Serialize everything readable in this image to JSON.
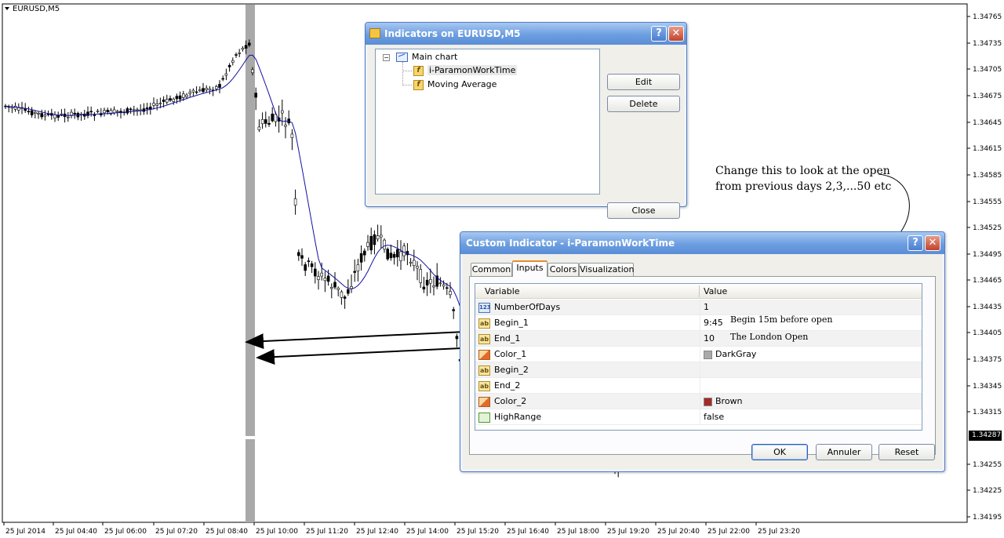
{
  "chart": {
    "title": "EURUSD,M5",
    "current_price": "1.34287",
    "price_labels": [
      "1.34765",
      "1.34735",
      "1.34705",
      "1.34675",
      "1.34645",
      "1.34615",
      "1.34585",
      "1.34555",
      "1.34525",
      "1.34495",
      "1.34465",
      "1.34435",
      "1.34405",
      "1.34375",
      "1.34345",
      "1.34315",
      "1.34255",
      "1.34225",
      "1.34195"
    ],
    "time_labels": [
      "25 Jul 2014",
      "25 Jul 04:40",
      "25 Jul 06:00",
      "25 Jul 07:20",
      "25 Jul 08:40",
      "25 Jul 10:00",
      "25 Jul 11:20",
      "25 Jul 12:40",
      "25 Jul 14:00",
      "25 Jul 15:20",
      "25 Jul 16:40",
      "25 Jul 18:00",
      "25 Jul 19:20",
      "25 Jul 20:40",
      "25 Jul 22:00",
      "25 Jul 23:20"
    ]
  },
  "indicators_dialog": {
    "title": "Indicators on EURUSD,M5",
    "tree": {
      "root": "Main chart",
      "children": [
        "i-ParamonWorkTime",
        "Moving Average"
      ]
    },
    "buttons": {
      "edit": "Edit",
      "delete": "Delete",
      "close": "Close"
    }
  },
  "custom_dialog": {
    "title": "Custom Indicator - i-ParamonWorkTime",
    "tabs": [
      "Common",
      "Inputs",
      "Colors",
      "Visualization"
    ],
    "active_tab": "Inputs",
    "columns": {
      "variable": "Variable",
      "value": "Value"
    },
    "rows": [
      {
        "variable": "NumberOfDays",
        "value": "1",
        "type": "int"
      },
      {
        "variable": "Begin_1",
        "value": "9:45",
        "type": "string"
      },
      {
        "variable": "End_1",
        "value": "10",
        "type": "string"
      },
      {
        "variable": "Color_1",
        "value": "DarkGray",
        "type": "color",
        "color": "#a9a9a9"
      },
      {
        "variable": "Begin_2",
        "value": "",
        "type": "string"
      },
      {
        "variable": "End_2",
        "value": "",
        "type": "string"
      },
      {
        "variable": "Color_2",
        "value": "Brown",
        "type": "color",
        "color": "#a52a2a"
      },
      {
        "variable": "HighRange",
        "value": "false",
        "type": "bool"
      }
    ],
    "buttons": {
      "ok": "OK",
      "cancel": "Annuler",
      "reset": "Reset"
    }
  },
  "annotations": {
    "note_line1": "Change this to look at the open",
    "note_line2": "from previous days 2,3,...50 etc",
    "begin_note": "Begin 15m before open",
    "end_note": "The London Open"
  }
}
